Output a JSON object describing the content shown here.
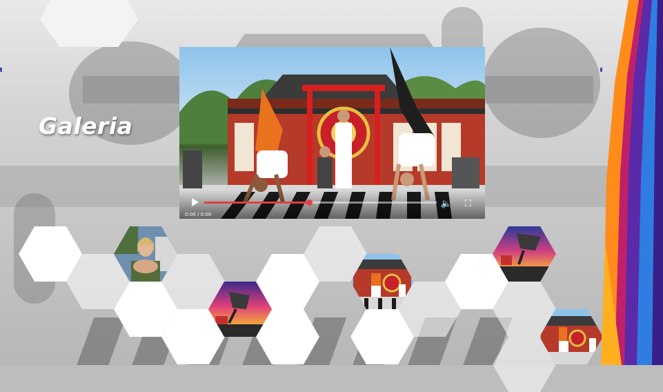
{
  "page": {
    "title": "Galeria"
  },
  "video": {
    "timecode": "0:00 / 0:00",
    "progress": 0.45,
    "controls": {
      "play_icon": "play-icon",
      "volume_icon": "volume-icon",
      "fullscreen_icon": "fullscreen-icon"
    }
  },
  "gallery": {
    "thumbnails": [
      {
        "name": "thumb-portrait",
        "kind": "portrait"
      },
      {
        "name": "thumb-skate-sunset-1",
        "kind": "skate-sunset"
      },
      {
        "name": "thumb-breakdance-temple-1",
        "kind": "breakdance-temple"
      },
      {
        "name": "thumb-skate-sunset-2",
        "kind": "skate-sunset"
      },
      {
        "name": "thumb-breakdance-temple-2",
        "kind": "breakdance-temple"
      }
    ]
  },
  "colors": {
    "accent_orange": "#ff8c1a",
    "accent_purple": "#5a2aa8",
    "accent_blue": "#2f7de1",
    "accent_magenta": "#c0206a"
  }
}
